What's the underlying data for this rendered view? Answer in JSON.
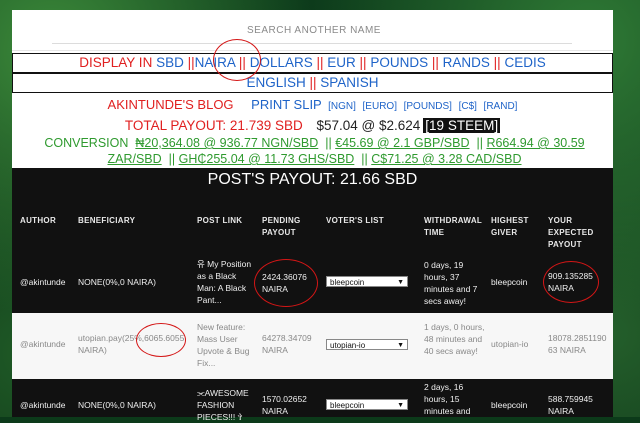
{
  "search": {
    "placeholder": "SEARCH ANOTHER NAME"
  },
  "display": {
    "prefix": "DISPLAY IN",
    "currencies": [
      "SBD",
      "NAIRA",
      "DOLLARS",
      "EUR",
      "POUNDS",
      "RANDS",
      "CEDIS"
    ],
    "languages": [
      "ENGLISH",
      "SPANISH"
    ],
    "separator": "||"
  },
  "blog": {
    "title": "AKINTUNDE'S BLOG",
    "slip": "PRINT SLIP",
    "slip_options": [
      "[NGN]",
      "[EURO]",
      "[POUNDS]",
      "[C$]",
      "[RAND]"
    ]
  },
  "total": {
    "label": "TOTAL PAYOUT: 21.739 SBD",
    "rate": "$57.04 @ $2.624",
    "steem": "[19 STEEM]"
  },
  "conversion": {
    "label": "CONVERSION",
    "items": [
      "₦20,364.08 @ 936.77 NGN/SBD",
      "€45.69 @ 2.1 GBP/SBD",
      "R664.94 @ 30.59 ZAR/SBD",
      "GH₵255.04 @ 11.73 GHS/SBD",
      "C$71.25 @ 3.28 CAD/SBD"
    ]
  },
  "post_payout": "POST'S PAYOUT: 21.66 SBD",
  "table": {
    "headers": [
      "AUTHOR",
      "BENEFICIARY",
      "POST LINK",
      "PENDING PAYOUT",
      "VOTER'S LIST",
      "WITHDRAWAL TIME",
      "HIGHEST GIVER",
      "YOUR EXPECTED PAYOUT"
    ],
    "rows": [
      {
        "author": "@akintunde",
        "beneficiary": "NONE(0%,0 NAIRA)",
        "post_link": "유 My Position as a Black Man: A Black Pant...",
        "pending": "2424.36076 NAIRA",
        "voter": "bleepcoin",
        "withdrawal": "0 days, 19 hours, 37 minutes and 7 secs away!",
        "giver": "bleepcoin",
        "expected": "909.135285 NAIRA"
      },
      {
        "author": "@akintunde",
        "beneficiary": "utopian.pay(25%,6065.6055 NAIRA)",
        "post_link": "New feature: Mass User Upvote & Bug Fix...",
        "pending": "64278.34709 NAIRA",
        "voter": "utopian-io",
        "withdrawal": "1 days, 0 hours, 48 minutes and 40 secs away!",
        "giver": "utopian-io",
        "expected": "18078.285119063 NAIRA"
      },
      {
        "author": "@akintunde",
        "beneficiary": "NONE(0%,0 NAIRA)",
        "post_link": "⫘AWESOME FASHION PIECES!!! ✞",
        "pending": "1570.02652 NAIRA",
        "voter": "bleepcoin",
        "withdrawal": "2 days, 16 hours, 15 minutes and",
        "giver": "bleepcoin",
        "expected": "588.759945 NAIRA"
      }
    ]
  },
  "colors": {
    "red": "#e02020",
    "blue": "#1e63c8",
    "green": "#2f9a2f",
    "dark": "#111111",
    "circle": "#d41616"
  }
}
